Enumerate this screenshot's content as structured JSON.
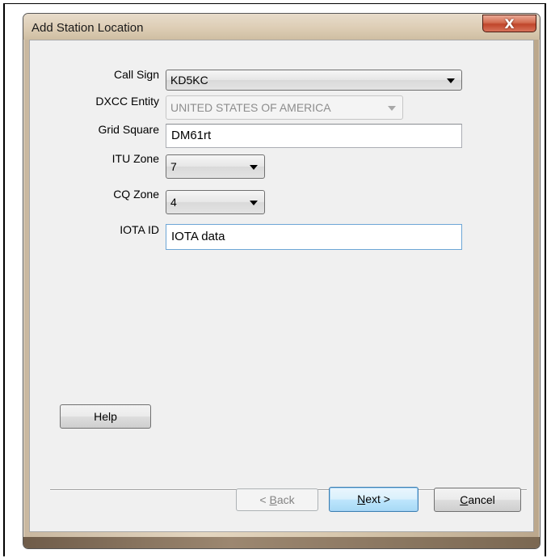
{
  "window": {
    "title": "Add Station Location",
    "close_label": "X"
  },
  "form": {
    "call_sign": {
      "label": "Call Sign",
      "value": "KD5KC"
    },
    "dxcc_entity": {
      "label": "DXCC Entity",
      "value": "UNITED STATES OF AMERICA",
      "disabled": true
    },
    "grid_square": {
      "label": "Grid Square",
      "value": "DM61rt"
    },
    "itu_zone": {
      "label": "ITU Zone",
      "value": "7"
    },
    "cq_zone": {
      "label": "CQ Zone",
      "value": "4"
    },
    "iota_id": {
      "label": "IOTA ID",
      "value": "IOTA data"
    }
  },
  "buttons": {
    "help": "Help",
    "back_prefix": "< ",
    "back_mnemonic": "B",
    "back_rest": "ack",
    "next_mnemonic": "N",
    "next_rest": "ext >",
    "cancel_mnemonic": "C",
    "cancel_rest": "ancel"
  },
  "colors": {
    "titlebar": "#ddcdb5",
    "client_bg": "#f0f0f0",
    "close_button": "#c0452a",
    "default_button": "#bee6fd"
  }
}
